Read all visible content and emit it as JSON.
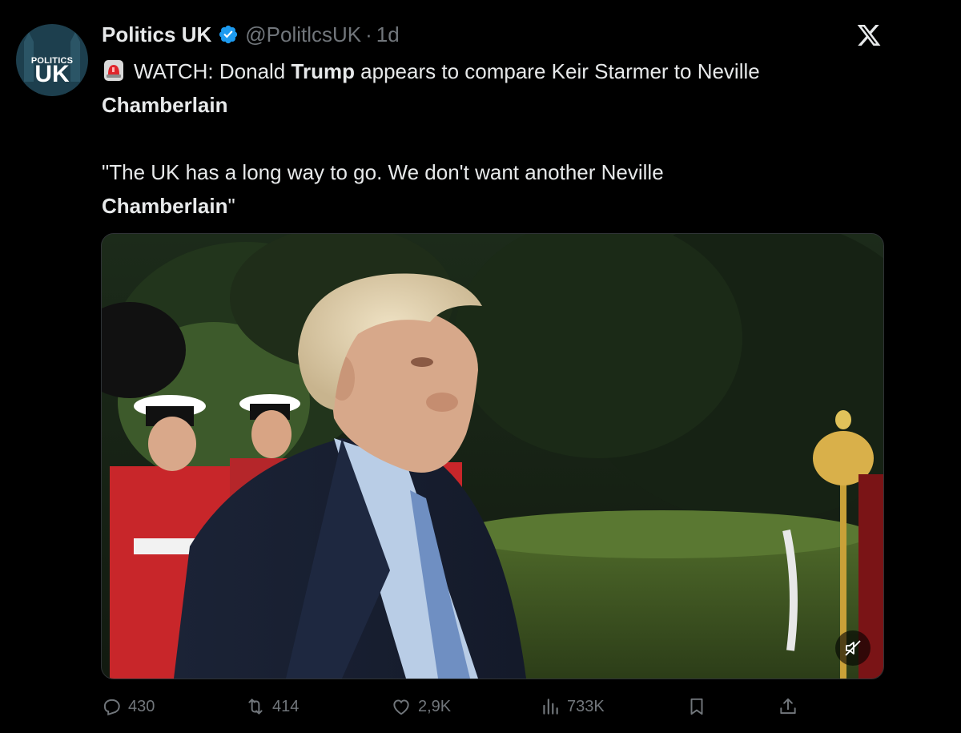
{
  "account": {
    "avatar_top": "POLITICS",
    "avatar_bottom": "UK",
    "name": "Politics UK",
    "handle": "@PolitlcsUK",
    "separator": "·",
    "time": "1d"
  },
  "tweet": {
    "line1_prefix": "WATCH: Donald ",
    "line1_bold": "Trump",
    "line1_suffix": " appears to compare Keir Starmer to Neville",
    "line2_bold": "Chamberlain",
    "quote_prefix": "\"The UK has a long way to go. We don't want another Neville",
    "quote_bold": "Chamberlain",
    "quote_suffix": "\""
  },
  "actions": {
    "replies": "430",
    "reposts": "414",
    "likes": "2,9K",
    "views": "733K"
  },
  "icons": [
    "verified-badge-icon",
    "x-logo-icon",
    "siren-icon",
    "mute-icon",
    "reply-icon",
    "repost-icon",
    "like-icon",
    "views-icon",
    "bookmark-icon",
    "share-icon"
  ],
  "colors": {
    "background": "#000000",
    "text": "#e7e9ea",
    "muted": "#71767b",
    "verified": "#1d9bf0"
  }
}
